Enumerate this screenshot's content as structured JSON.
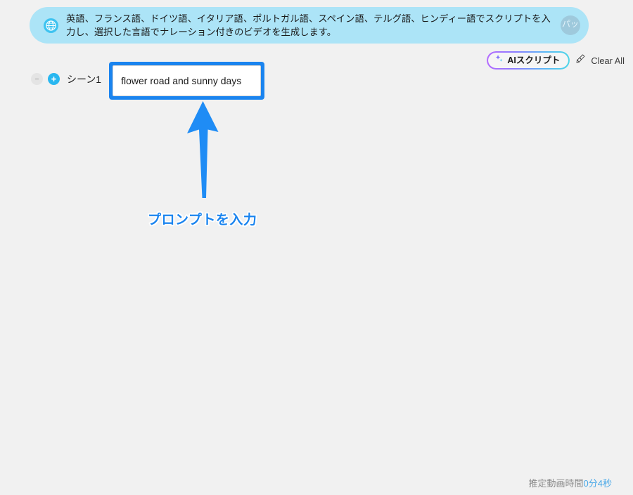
{
  "banner": {
    "icon": "globe-info-icon",
    "message": "英語、フランス語、ドイツ語、イタリア語、ポルトガル語、スペイン語、テルグ語、ヒンディー語でスクリプトを入力し、選択した言語でナレーション付きのビデオを生成します。",
    "close_label": "パッ",
    "background_color": "#ace4f7"
  },
  "toolbar": {
    "ai_script_label": "AIスクリプト",
    "ai_script_icon": "sparkle-icon",
    "clear_all_label": "Clear All",
    "clear_all_icon": "brush-icon"
  },
  "scene": {
    "remove_icon": "minus-circle-icon",
    "add_icon": "plus-circle-icon",
    "label": "シーン1",
    "input_value": "flower road and sunny days",
    "input_placeholder": "",
    "highlight_color": "#1a84ef"
  },
  "annotation": {
    "arrow_icon": "up-arrow-icon",
    "text": "プロンプトを入力",
    "color": "#1a84ef"
  },
  "footer": {
    "duration_label": "推定動画時間",
    "duration_value": "0分4秒"
  }
}
